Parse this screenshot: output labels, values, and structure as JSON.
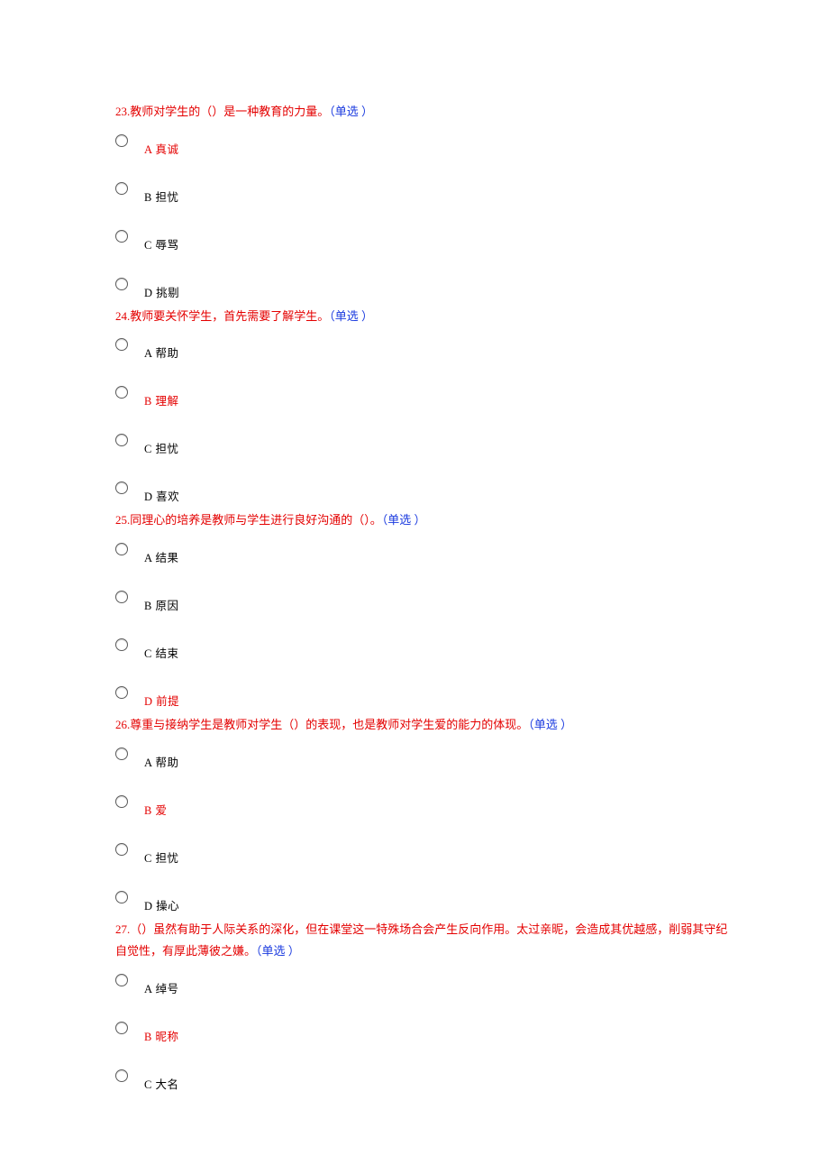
{
  "type_label": "（单选 ）",
  "questions": [
    {
      "num": "23.",
      "body": "教师对学生的（）是一种教育的力量。",
      "options": [
        {
          "letter": "A",
          "text": "真诚",
          "highlight": true
        },
        {
          "letter": "B",
          "text": "担忧",
          "highlight": false
        },
        {
          "letter": "C",
          "text": "辱骂",
          "highlight": false
        },
        {
          "letter": "D",
          "text": "挑剔",
          "highlight": false
        }
      ]
    },
    {
      "num": "24.",
      "body": "教师要关怀学生，首先需要了解学生。",
      "options": [
        {
          "letter": "A",
          "text": "帮助",
          "highlight": false
        },
        {
          "letter": "B",
          "text": "理解",
          "highlight": true
        },
        {
          "letter": "C",
          "text": "担忧",
          "highlight": false
        },
        {
          "letter": "D",
          "text": "喜欢",
          "highlight": false
        }
      ]
    },
    {
      "num": "25.",
      "body": "同理心的培养是教师与学生进行良好沟通的（）。",
      "options": [
        {
          "letter": "A",
          "text": "结果",
          "highlight": false
        },
        {
          "letter": "B",
          "text": "原因",
          "highlight": false
        },
        {
          "letter": "C",
          "text": "结束",
          "highlight": false
        },
        {
          "letter": "D",
          "text": "前提",
          "highlight": true
        }
      ]
    },
    {
      "num": "26.",
      "body": "尊重与接纳学生是教师对学生（）的表现，也是教师对学生爱的能力的体现。",
      "options": [
        {
          "letter": "A",
          "text": "帮助",
          "highlight": false
        },
        {
          "letter": "B",
          "text": "爱",
          "highlight": true
        },
        {
          "letter": "C",
          "text": "担忧",
          "highlight": false
        },
        {
          "letter": "D",
          "text": "操心",
          "highlight": false
        }
      ]
    },
    {
      "num": "27.",
      "body": "（）虽然有助于人际关系的深化，但在课堂这一特殊场合会产生反向作用。太过亲昵，会造成其优越感，削弱其守纪自觉性，有厚此薄彼之嫌。",
      "options": [
        {
          "letter": "A",
          "text": "绰号",
          "highlight": false
        },
        {
          "letter": "B",
          "text": "昵称",
          "highlight": true
        },
        {
          "letter": "C",
          "text": "大名",
          "highlight": false
        }
      ]
    }
  ]
}
